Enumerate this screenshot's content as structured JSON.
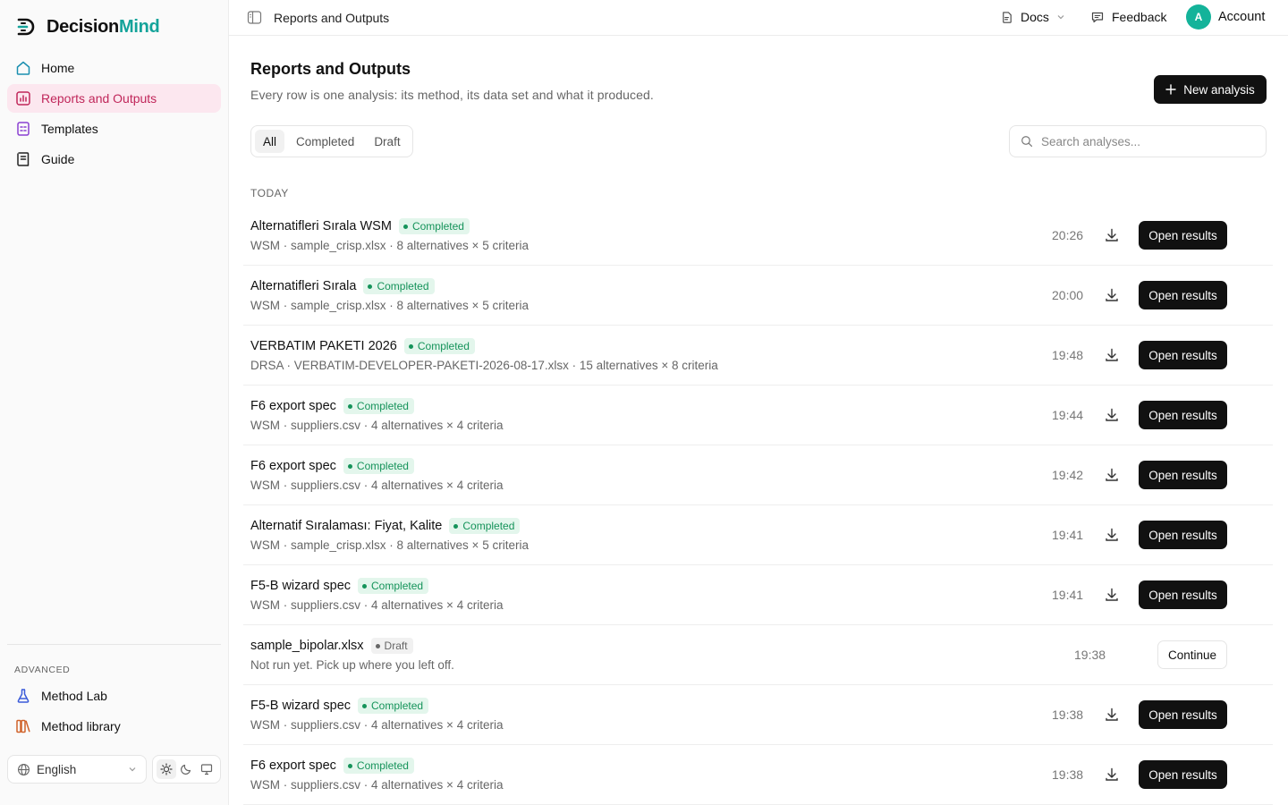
{
  "brand": {
    "name_part1": "Decision",
    "name_part2": "Mind",
    "accent": "#14a39a"
  },
  "sidebar": {
    "items": [
      {
        "label": "Home",
        "icon": "home-icon",
        "active": false
      },
      {
        "label": "Reports and Outputs",
        "icon": "reports-icon",
        "active": true
      },
      {
        "label": "Templates",
        "icon": "templates-icon",
        "active": false
      },
      {
        "label": "Guide",
        "icon": "book-icon",
        "active": false
      }
    ],
    "advanced_label": "ADVANCED",
    "advanced_items": [
      {
        "label": "Method Lab",
        "icon": "flask-icon"
      },
      {
        "label": "Method library",
        "icon": "library-icon"
      }
    ],
    "language": "English",
    "theme_options": [
      "light",
      "dark",
      "system"
    ]
  },
  "topbar": {
    "title": "Reports and Outputs",
    "docs": "Docs",
    "feedback": "Feedback",
    "avatar_initial": "A",
    "account": "Account"
  },
  "main": {
    "title": "Reports and Outputs",
    "subtitle": "Every row is one analysis: its method, its data set and what it produced.",
    "new_button": "New analysis",
    "tabs": [
      {
        "label": "All",
        "active": true
      },
      {
        "label": "Completed",
        "active": false
      },
      {
        "label": "Draft",
        "active": false
      }
    ],
    "search_placeholder": "Search analyses...",
    "section_label": "TODAY",
    "rows": [
      {
        "title": "Alternatifleri Sırala WSM",
        "status": "Completed",
        "meta": "WSM · sample_crisp.xlsx · 8 alternatives × 5 criteria",
        "time": "20:26",
        "action": "Open results"
      },
      {
        "title": "Alternatifleri Sırala",
        "status": "Completed",
        "meta": "WSM · sample_crisp.xlsx · 8 alternatives × 5 criteria",
        "time": "20:00",
        "action": "Open results"
      },
      {
        "title": "VERBATIM PAKETI 2026",
        "status": "Completed",
        "meta": "DRSA · VERBATIM-DEVELOPER-PAKETI-2026-08-17.xlsx · 15 alternatives × 8 criteria",
        "time": "19:48",
        "action": "Open results"
      },
      {
        "title": "F6 export spec",
        "status": "Completed",
        "meta": "WSM · suppliers.csv · 4 alternatives × 4 criteria",
        "time": "19:44",
        "action": "Open results"
      },
      {
        "title": "F6 export spec",
        "status": "Completed",
        "meta": "WSM · suppliers.csv · 4 alternatives × 4 criteria",
        "time": "19:42",
        "action": "Open results"
      },
      {
        "title": "Alternatif Sıralaması: Fiyat, Kalite",
        "status": "Completed",
        "meta": "WSM · sample_crisp.xlsx · 8 alternatives × 5 criteria",
        "time": "19:41",
        "action": "Open results"
      },
      {
        "title": "F5-B wizard spec",
        "status": "Completed",
        "meta": "WSM · suppliers.csv · 4 alternatives × 4 criteria",
        "time": "19:41",
        "action": "Open results"
      },
      {
        "title": "sample_bipolar.xlsx",
        "status": "Draft",
        "meta": "Not run yet. Pick up where you left off.",
        "time": "19:38",
        "action": "Continue"
      },
      {
        "title": "F5-B wizard spec",
        "status": "Completed",
        "meta": "WSM · suppliers.csv · 4 alternatives × 4 criteria",
        "time": "19:38",
        "action": "Open results"
      },
      {
        "title": "F6 export spec",
        "status": "Completed",
        "meta": "WSM · suppliers.csv · 4 alternatives × 4 criteria",
        "time": "19:38",
        "action": "Open results"
      }
    ]
  },
  "colors": {
    "active_nav_bg": "#fce7ef",
    "active_nav_text": "#c0265a",
    "completed": "#15935a",
    "avatar": "#14b39a"
  }
}
